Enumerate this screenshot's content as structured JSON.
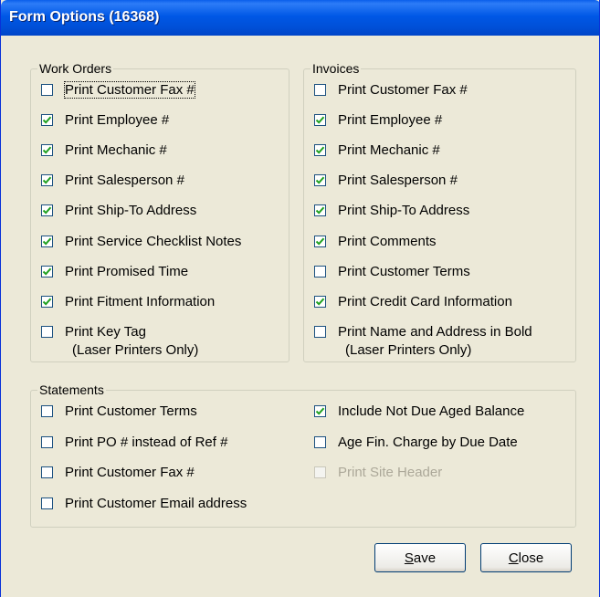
{
  "window": {
    "title": "Form Options (16368)"
  },
  "work_orders": {
    "legend": "Work Orders",
    "items": [
      {
        "label": "Print Customer Fax #",
        "checked": false
      },
      {
        "label": "Print Employee #",
        "checked": true
      },
      {
        "label": "Print Mechanic #",
        "checked": true
      },
      {
        "label": "Print Salesperson #",
        "checked": true
      },
      {
        "label": "Print Ship-To Address",
        "checked": true
      },
      {
        "label": "Print Service Checklist Notes",
        "checked": true
      },
      {
        "label": "Print Promised Time",
        "checked": true
      },
      {
        "label": "Print Fitment Information",
        "checked": true
      },
      {
        "label": "Print Key Tag",
        "sublabel": "(Laser Printers Only)",
        "checked": false
      }
    ]
  },
  "invoices": {
    "legend": "Invoices",
    "items": [
      {
        "label": "Print Customer Fax #",
        "checked": false
      },
      {
        "label": "Print Employee #",
        "checked": true
      },
      {
        "label": "Print Mechanic #",
        "checked": true
      },
      {
        "label": "Print Salesperson #",
        "checked": true
      },
      {
        "label": "Print Ship-To Address",
        "checked": true
      },
      {
        "label": "Print Comments",
        "checked": true
      },
      {
        "label": "Print Customer Terms",
        "checked": false
      },
      {
        "label": "Print Credit Card Information",
        "checked": true
      },
      {
        "label": "Print Name and Address in Bold",
        "sublabel": "(Laser Printers Only)",
        "checked": false
      }
    ]
  },
  "statements": {
    "legend": "Statements",
    "left_items": [
      {
        "label": "Print Customer Terms",
        "checked": false
      },
      {
        "label": "Print PO # instead of Ref #",
        "checked": false
      },
      {
        "label": "Print Customer Fax #",
        "checked": false
      },
      {
        "label": "Print Customer Email address",
        "checked": false
      }
    ],
    "right_items": [
      {
        "label": "Include Not Due Aged Balance",
        "checked": true
      },
      {
        "label": "Age Fin. Charge by Due Date",
        "checked": false
      },
      {
        "label": "Print Site Header",
        "checked": false,
        "disabled": true
      }
    ]
  },
  "buttons": {
    "save": {
      "accel": "S",
      "rest": "ave"
    },
    "close": {
      "accel": "C",
      "rest": "lose"
    }
  }
}
